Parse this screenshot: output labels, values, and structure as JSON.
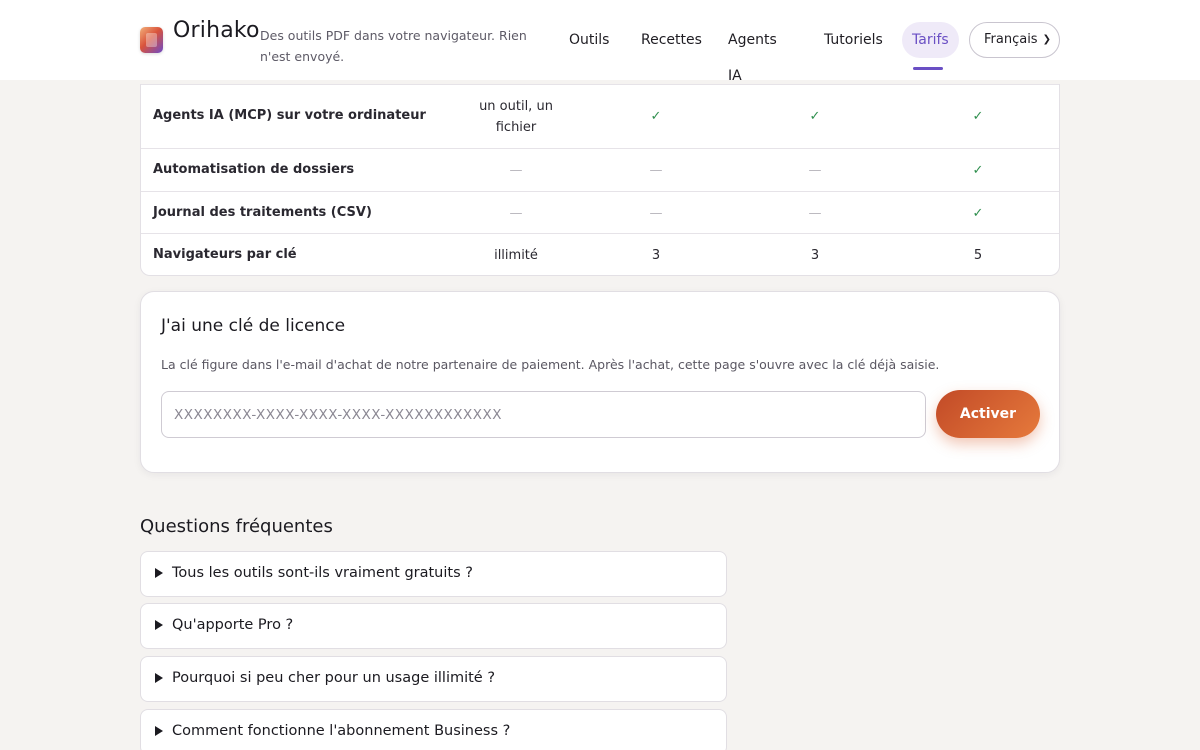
{
  "header": {
    "brand": "Orihako",
    "tagline": "Des outils PDF dans votre navigateur. Rien n'est envoyé.",
    "nav": [
      {
        "label": "Outils"
      },
      {
        "label": "Recettes"
      },
      {
        "label": "Agents IA"
      },
      {
        "label": "Tutoriels"
      },
      {
        "label": "Tarifs",
        "active": true
      }
    ],
    "language": "Français",
    "accent_color": "#6a4fc4"
  },
  "table": {
    "rows": [
      {
        "label": "Agents IA (MCP) sur votre ordinateur",
        "values": [
          "un outil, un fichier",
          "✓",
          "✓",
          "✓"
        ]
      },
      {
        "label": "Automatisation de dossiers",
        "values": [
          "—",
          "—",
          "—",
          "✓"
        ]
      },
      {
        "label": "Journal des traitements (CSV)",
        "values": [
          "—",
          "—",
          "—",
          "✓"
        ]
      },
      {
        "label": "Navigateurs par clé",
        "values": [
          "illimité",
          "3",
          "3",
          "5"
        ]
      }
    ]
  },
  "license": {
    "title": "J'ai une clé de licence",
    "description": "La clé figure dans l'e-mail d'achat de notre partenaire de paiement. Après l'achat, cette page s'ouvre avec la clé déjà saisie.",
    "placeholder": "XXXXXXXX-XXXX-XXXX-XXXX-XXXXXXXXXXXX",
    "value": "",
    "button": "Activer",
    "button_color": "#d65f2d"
  },
  "faq": {
    "heading": "Questions fréquentes",
    "items": [
      {
        "question": "Tous les outils sont-ils vraiment gratuits ?"
      },
      {
        "question": "Qu'apporte Pro ?"
      },
      {
        "question": "Pourquoi si peu cher pour un usage illimité ?"
      },
      {
        "question": "Comment fonctionne l'abonnement Business ?"
      }
    ]
  }
}
